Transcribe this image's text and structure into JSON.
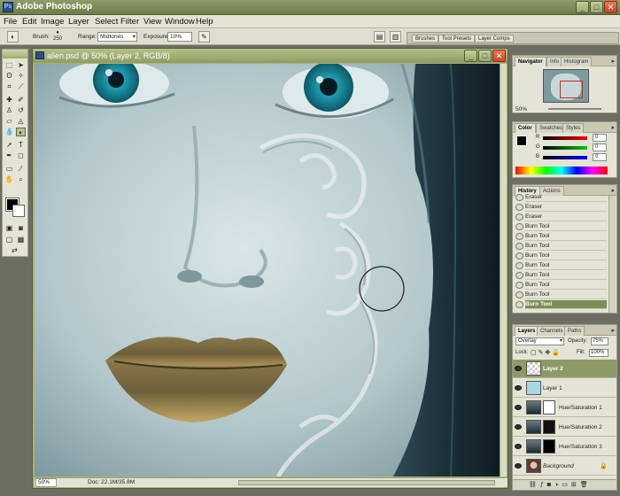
{
  "app": {
    "title": "Adobe Photoshop"
  },
  "menu": [
    "File",
    "Edit",
    "Image",
    "Layer",
    "Select",
    "Filter",
    "View",
    "Window",
    "Help"
  ],
  "options": {
    "brush_label": "Brush:",
    "brush_size": "250",
    "range_label": "Range:",
    "range_value": "Midtones",
    "exposure_label": "Exposure:",
    "exposure_value": "10%"
  },
  "palette_well": [
    "Brushes",
    "Tool Presets",
    "Layer Comps"
  ],
  "document": {
    "title": "alien.psd @ 50% (Layer 2, RGB/8)",
    "zoom": "50%",
    "doc_info": "Doc: 22.1M/35.8M"
  },
  "navigator": {
    "tabs": [
      "Navigator",
      "Info",
      "Histogram"
    ],
    "zoom": "50%"
  },
  "color": {
    "tabs": [
      "Color",
      "Swatches",
      "Styles"
    ],
    "channels": [
      {
        "label": "R",
        "value": "0"
      },
      {
        "label": "G",
        "value": "0"
      },
      {
        "label": "B",
        "value": "0"
      }
    ]
  },
  "history": {
    "tabs": [
      "History",
      "Actions"
    ],
    "items": [
      "Eraser",
      "Eraser",
      "Eraser",
      "Burn Tool",
      "Burn Tool",
      "Burn Tool",
      "Burn Tool",
      "Burn Tool",
      "Burn Tool",
      "Burn Tool",
      "Burn Tool",
      "Burn Tool"
    ],
    "selected_index": 11
  },
  "layers": {
    "tabs": [
      "Layers",
      "Channels",
      "Paths"
    ],
    "blend_mode": "Overlay",
    "opacity_label": "Opacity:",
    "opacity": "75%",
    "lock_label": "Lock:",
    "fill_label": "Fill:",
    "fill": "100%",
    "items": [
      {
        "name": "Layer 2",
        "selected": true
      },
      {
        "name": "Layer 1",
        "selected": false
      },
      {
        "name": "Hue/Saturation 1",
        "selected": false
      },
      {
        "name": "Hue/Saturation 2",
        "selected": false
      },
      {
        "name": "Hue/Saturation 3",
        "selected": false
      },
      {
        "name": "Background",
        "selected": false
      }
    ]
  }
}
